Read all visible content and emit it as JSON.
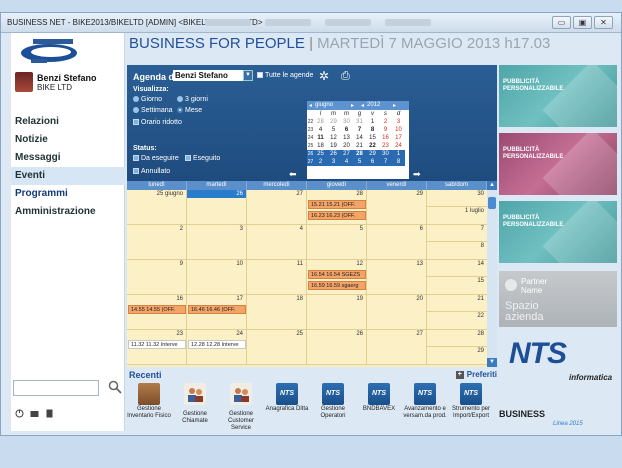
{
  "window": {
    "title": "BUSINESS NET - BIKE2013/BIKELTD [ADMIN] <BIKELTD - BIKE LTD>",
    "btn_min": "▭",
    "btn_max": "▣",
    "btn_close": "✕"
  },
  "sidebar": {
    "user_name": "Benzi Stefano",
    "user_company": "BIKE LTD",
    "items": [
      {
        "label": "Relazioni"
      },
      {
        "label": "Notizie"
      },
      {
        "label": "Messaggi"
      },
      {
        "label": "Eventi"
      },
      {
        "label": "Programmi"
      },
      {
        "label": "Amministrazione"
      }
    ]
  },
  "header": {
    "brand": "BUSINESS FOR PEOPLE",
    "separator": "|",
    "date": "MARTEDÌ 7 MAGGIO 2013 h17.03"
  },
  "agenda": {
    "label": "Agenda di",
    "selected": "Benzi Stefano",
    "tutte": "Tutte le agende",
    "visualizza": "Visualizza:",
    "opt_giorno": "Giorno",
    "opt_3giorni": "3 giorni",
    "opt_settimana": "Settimana",
    "opt_mese": "Mese",
    "orario_ridotto": "Orario ridotto",
    "status": "Status:",
    "da_eseguire": "Da eseguire",
    "eseguito": "Eseguito",
    "annullato": "Annullato"
  },
  "minical": {
    "month": "giugno",
    "year": "2012",
    "dow": [
      "l",
      "m",
      "m",
      "g",
      "v",
      "s",
      "d"
    ],
    "weeks": [
      {
        "wk": "22",
        "days": [
          "28",
          "29",
          "30",
          "31",
          "1",
          "2",
          "3"
        ]
      },
      {
        "wk": "23",
        "days": [
          "4",
          "5",
          "6",
          "7",
          "8",
          "9",
          "10"
        ]
      },
      {
        "wk": "24",
        "days": [
          "11",
          "12",
          "13",
          "14",
          "15",
          "16",
          "17"
        ]
      },
      {
        "wk": "25",
        "days": [
          "18",
          "19",
          "20",
          "21",
          "22",
          "23",
          "24"
        ]
      },
      {
        "wk": "26",
        "days": [
          "25",
          "26",
          "27",
          "28",
          "29",
          "30",
          "1"
        ]
      },
      {
        "wk": "27",
        "days": [
          "2",
          "3",
          "4",
          "5",
          "6",
          "7",
          "8"
        ]
      }
    ]
  },
  "calendar": {
    "headers": [
      "lunedì",
      "martedì",
      "mercoledì",
      "giovedì",
      "venerdì",
      "sab/dom"
    ],
    "weeks": [
      {
        "days": [
          "25 giugno",
          "26",
          "27",
          "28",
          "29"
        ],
        "sat": "30",
        "sun": "1 luglio"
      },
      {
        "days": [
          "2",
          "3",
          "4",
          "5",
          "6"
        ],
        "sat": "7",
        "sun": "8"
      },
      {
        "days": [
          "9",
          "10",
          "11",
          "12",
          "13"
        ],
        "sat": "14",
        "sun": "15"
      },
      {
        "days": [
          "16",
          "17",
          "18",
          "19",
          "20"
        ],
        "sat": "21",
        "sun": "22"
      },
      {
        "days": [
          "23",
          "24",
          "25",
          "26",
          "27"
        ],
        "sat": "28",
        "sun": "29"
      }
    ],
    "events": {
      "e1": "15.21 15.21  (OFF.",
      "e2": "16.23 16.23  (OFF.",
      "e3": "16.54 16.54  SGEZS",
      "e4": "16.59 16.59  sgaerg",
      "e5": "14.55 14.55  (OFF.",
      "e6": "16.46 16.46  (OFF.",
      "e7": "11.32 11.32  Interve",
      "e8": "12.28 12.28  Interve"
    }
  },
  "recenti": {
    "label": "Recenti",
    "preferiti": "Preferiti",
    "items": [
      {
        "label": "Gestione Inventario Fisico"
      },
      {
        "label": "Gestione Chiamate"
      },
      {
        "label": "Gestione Customer Service"
      },
      {
        "label": "Anagrafica Ditta",
        "icon": "NTS"
      },
      {
        "label": "Gestione Operatori",
        "icon": "NTS"
      },
      {
        "label": "BNDBAVEX",
        "icon": "NTS"
      },
      {
        "label": "Avanzamento e versam.da prod.",
        "icon": "NTS"
      },
      {
        "label": "Strumento per Import/Export",
        "icon": "NTS"
      }
    ]
  },
  "ads": {
    "tile1": "PUBBLICITÀ\nPERSONALIZZABILE",
    "tile2": "PUBBLICITÀ\nPERSONALIZZABILE",
    "tile3": "PUBBLICITÀ\nPERSONALIZZABILE",
    "partner1": "Partner",
    "partner2": "Name",
    "spazio1": "Spazio",
    "spazio2": "azienda",
    "nts": "NTS",
    "nts_sub": "informatica",
    "biz": "BUSINESS",
    "biz_sub": "Linea 2015"
  },
  "colors": {
    "brand": "#22509a",
    "filters_bg": "#2a5e94",
    "calendar_bg": "#fbf0c6",
    "event_orange": "#f3a469"
  }
}
